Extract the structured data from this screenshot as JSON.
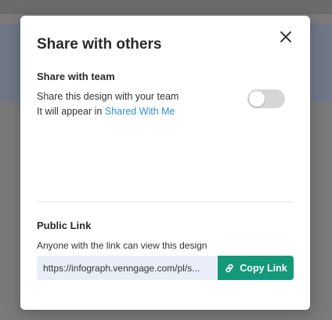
{
  "modal": {
    "title": "Share with others",
    "close_icon": "close-icon"
  },
  "team": {
    "heading": "Share with team",
    "line1": "Share this design with your team",
    "line2_prefix": "It will appear in ",
    "line2_link": "Shared With Me",
    "toggle_on": false
  },
  "public_link": {
    "heading": "Public Link",
    "description": "Anyone with the link can view this design",
    "url": "https://infograph.venngage.com/pl/s...",
    "copy_label": "Copy Link",
    "copy_icon": "link-icon"
  },
  "colors": {
    "accent": "#14987a",
    "link": "#2f8fd6",
    "input_bg": "#e9eef8"
  }
}
